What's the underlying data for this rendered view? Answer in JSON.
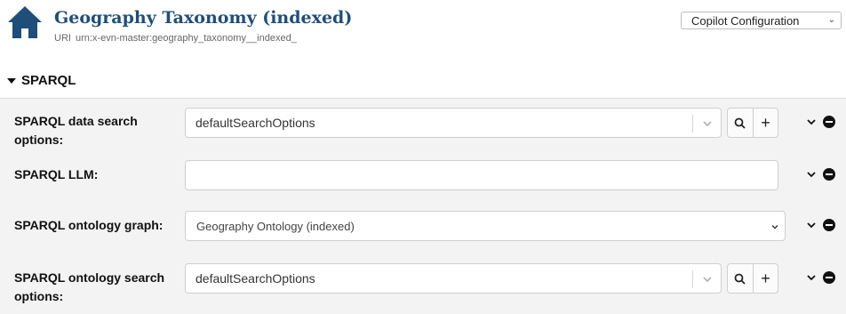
{
  "header": {
    "title": "Geography Taxonomy (indexed)",
    "uri_label": "URI",
    "uri_value": "urn:x-evn-master:geography_taxonomy__indexed_",
    "home_icon": "home-icon",
    "config_select": {
      "value": "Copilot Configuration",
      "icon": "chevron-down-icon"
    }
  },
  "section": {
    "title": "SPARQL",
    "collapse_icon": "caret-down-icon"
  },
  "fields": [
    {
      "label": "SPARQL data search options:",
      "control": "select",
      "value": "defaultSearchOptions",
      "buttons": [
        "search-icon",
        "plus-icon"
      ]
    },
    {
      "label": "SPARQL LLM:",
      "control": "text",
      "value": ""
    },
    {
      "label": "SPARQL ontology graph:",
      "control": "native-select",
      "value": "Geography Ontology (indexed)"
    },
    {
      "label": "SPARQL ontology search options:",
      "control": "select",
      "value": "defaultSearchOptions",
      "buttons": [
        "search-icon",
        "plus-icon"
      ]
    }
  ],
  "row_actions": [
    "chevron-down-icon",
    "remove-icon"
  ],
  "colors": {
    "title": "#1f4e7a",
    "home_icon": "#1f4e7a",
    "body_background": "#f3f3f3"
  }
}
